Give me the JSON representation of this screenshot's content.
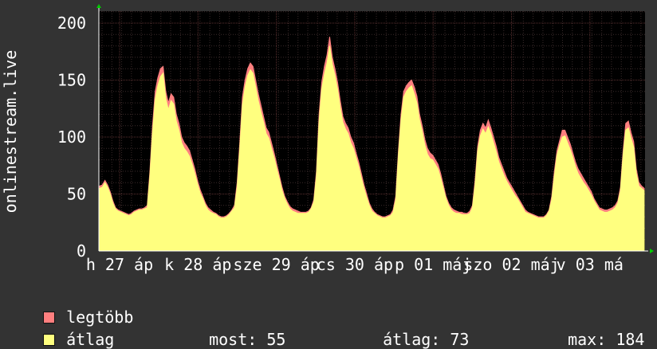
{
  "chart_data": {
    "type": "area",
    "ylabel": "onlinestream.live",
    "ylim": [
      0,
      210
    ],
    "yticks": [
      0,
      50,
      100,
      150,
      200
    ],
    "grid": true,
    "xtick_labels": [
      "h 27 áp",
      "k 28 áp",
      "sze 29 áp",
      "cs 30 áp",
      "p 01 máj",
      "szo 02 máj",
      "v 03 má"
    ],
    "x_days_span": 7,
    "series": [
      {
        "name": "legtöbb",
        "color": "#ff7f7f",
        "values": [
          57,
          58,
          62,
          58,
          52,
          44,
          38,
          36,
          35,
          34,
          33,
          32,
          33,
          35,
          36,
          37,
          37,
          38,
          40,
          70,
          110,
          140,
          152,
          160,
          162,
          140,
          130,
          138,
          135,
          120,
          112,
          100,
          95,
          92,
          88,
          80,
          72,
          62,
          54,
          48,
          42,
          38,
          36,
          34,
          33,
          31,
          30,
          30,
          31,
          33,
          36,
          40,
          60,
          95,
          135,
          150,
          160,
          165,
          162,
          150,
          138,
          128,
          118,
          108,
          104,
          95,
          86,
          76,
          66,
          56,
          48,
          43,
          39,
          37,
          36,
          35,
          34,
          34,
          34,
          35,
          38,
          45,
          70,
          120,
          148,
          162,
          172,
          188,
          170,
          160,
          148,
          132,
          118,
          112,
          108,
          100,
          95,
          86,
          78,
          68,
          58,
          50,
          42,
          37,
          34,
          32,
          31,
          30,
          30,
          31,
          32,
          36,
          48,
          88,
          120,
          140,
          145,
          148,
          150,
          144,
          136,
          120,
          110,
          98,
          90,
          86,
          84,
          80,
          76,
          68,
          58,
          48,
          42,
          38,
          36,
          35,
          34,
          34,
          33,
          33,
          35,
          40,
          62,
          92,
          106,
          112,
          108,
          115,
          108,
          100,
          92,
          82,
          76,
          70,
          64,
          60,
          56,
          52,
          48,
          44,
          40,
          36,
          34,
          33,
          32,
          31,
          30,
          30,
          30,
          32,
          36,
          48,
          70,
          88,
          97,
          106,
          106,
          100,
          94,
          86,
          78,
          72,
          68,
          64,
          60,
          56,
          52,
          46,
          42,
          38,
          37,
          36,
          36,
          37,
          38,
          40,
          44,
          56,
          88,
          112,
          114,
          104,
          96,
          72,
          60,
          57,
          55
        ]
      },
      {
        "name": "átlag",
        "color": "#ffff7f",
        "values": [
          55,
          56,
          60,
          56,
          50,
          42,
          37,
          35,
          34,
          33,
          32,
          31,
          32,
          34,
          35,
          36,
          36,
          37,
          38,
          66,
          104,
          133,
          145,
          153,
          156,
          134,
          124,
          132,
          129,
          114,
          106,
          95,
          90,
          87,
          83,
          76,
          68,
          59,
          51,
          46,
          40,
          36,
          34,
          33,
          32,
          30,
          29,
          29,
          30,
          32,
          35,
          38,
          56,
          90,
          128,
          144,
          154,
          159,
          156,
          144,
          132,
          122,
          113,
          103,
          99,
          90,
          82,
          72,
          63,
          53,
          46,
          41,
          37,
          35,
          34,
          33,
          33,
          33,
          33,
          34,
          37,
          43,
          66,
          114,
          142,
          155,
          165,
          180,
          164,
          154,
          142,
          126,
          113,
          107,
          103,
          95,
          90,
          82,
          74,
          64,
          55,
          47,
          40,
          35,
          33,
          31,
          30,
          29,
          29,
          30,
          31,
          34,
          45,
          84,
          115,
          135,
          140,
          143,
          145,
          138,
          130,
          115,
          105,
          93,
          85,
          81,
          80,
          76,
          72,
          64,
          55,
          46,
          40,
          36,
          34,
          33,
          33,
          32,
          32,
          32,
          33,
          38,
          58,
          88,
          101,
          107,
          103,
          109,
          103,
          95,
          87,
          78,
          72,
          66,
          61,
          57,
          53,
          49,
          46,
          42,
          38,
          34,
          33,
          32,
          31,
          30,
          29,
          29,
          29,
          31,
          35,
          45,
          66,
          84,
          93,
          100,
          101,
          95,
          89,
          82,
          74,
          68,
          64,
          60,
          57,
          53,
          49,
          44,
          40,
          36,
          35,
          34,
          34,
          35,
          36,
          38,
          42,
          53,
          84,
          106,
          108,
          99,
          91,
          68,
          57,
          55,
          53
        ]
      }
    ]
  },
  "stats": {
    "most_label": "most:",
    "most_value": "55",
    "avg_label": "átlag:",
    "avg_value": "73",
    "max_label": "max:",
    "max_value": "184"
  }
}
